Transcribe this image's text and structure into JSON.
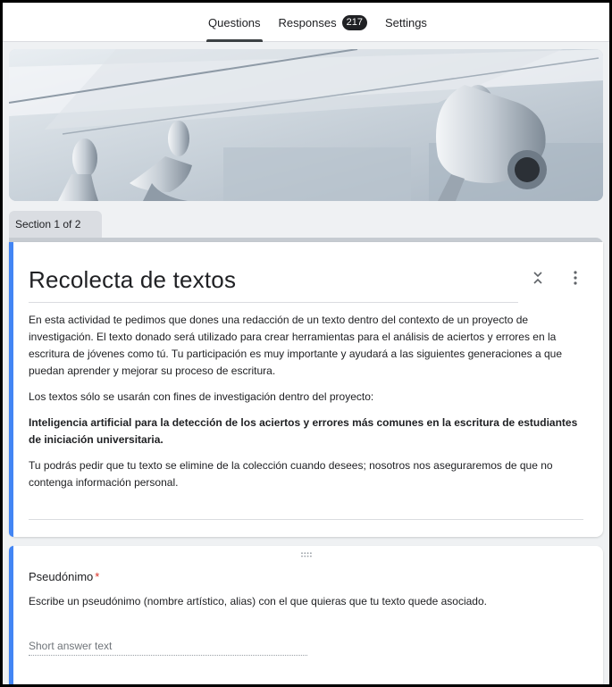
{
  "tabs": [
    {
      "label": "Questions",
      "active": true
    },
    {
      "label": "Responses",
      "badge": "217"
    },
    {
      "label": "Settings"
    }
  ],
  "section": {
    "label": "Section 1 of 2"
  },
  "form": {
    "title": "Recolecta de textos",
    "description": [
      "En esta actividad te pedimos que dones una redacción de un texto dentro del contexto de un proyecto de investigación. El texto donado será utilizado para crear herramientas para el análisis de aciertos y errores en la escritura de jóvenes como tú. Tu participación es muy importante y ayudará a las siguientes generaciones a que puedan aprender y mejorar su proceso de escritura.",
      "Los textos sólo se usarán con fines de investigación dentro del proyecto:",
      "Inteligencia artificial para la detección de los aciertos y errores más comunes en la escritura de estudiantes de iniciación universitaria.",
      "Tu podrás pedir que tu texto se elimine de la colección cuando desees; nosotros nos aseguraremos de que no contenga información personal."
    ]
  },
  "question": {
    "title": "Pseudónimo",
    "required_mark": "*",
    "description": "Escribe un pseudónimo (nombre artístico, alias) con el que quieras que tu texto quede asociado.",
    "placeholder": "Short answer text"
  },
  "colors": {
    "accent": "#4285f4",
    "required": "#d93025",
    "badge": "#202124"
  },
  "icons": {
    "collapse": "collapse-icon",
    "more": "more-vert-icon",
    "drag": "drag-handle-icon"
  }
}
